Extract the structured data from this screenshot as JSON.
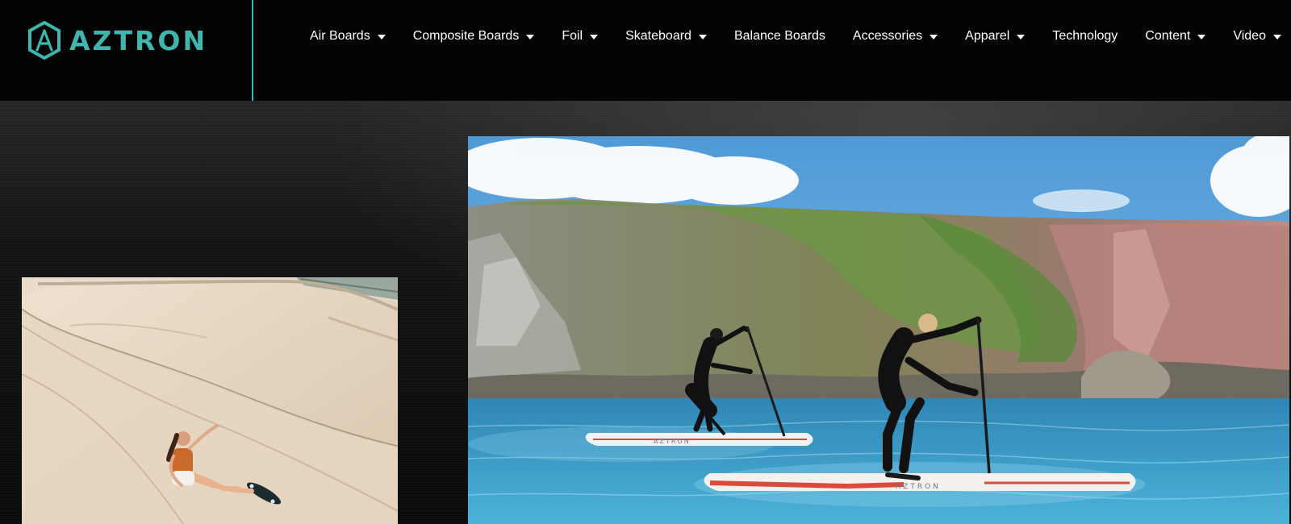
{
  "brand": {
    "name": "AZTRON",
    "accent": "#3fb5ad"
  },
  "nav": {
    "items": [
      {
        "label": "Air Boards",
        "dropdown": true
      },
      {
        "label": "Composite Boards",
        "dropdown": true
      },
      {
        "label": "Foil",
        "dropdown": true
      },
      {
        "label": "Skateboard",
        "dropdown": true
      },
      {
        "label": "Balance Boards",
        "dropdown": false
      },
      {
        "label": "Accessories",
        "dropdown": true
      },
      {
        "label": "Apparel",
        "dropdown": true
      },
      {
        "label": "Technology",
        "dropdown": false
      },
      {
        "label": "Content",
        "dropdown": true
      },
      {
        "label": "Video",
        "dropdown": true
      }
    ]
  },
  "images": {
    "left": {
      "subject": "skater-in-concrete-bowl"
    },
    "right": {
      "subject": "paddleboarders-below-sea-cliffs",
      "board_text": "AZTRON"
    }
  },
  "colors": {
    "background": "#000000",
    "nav_text": "#ffffff",
    "sea": "#3b9fc9",
    "sky": "#6fb2e3",
    "cliff_green": "#6f8f45",
    "bowl": "#e4d3bd"
  }
}
